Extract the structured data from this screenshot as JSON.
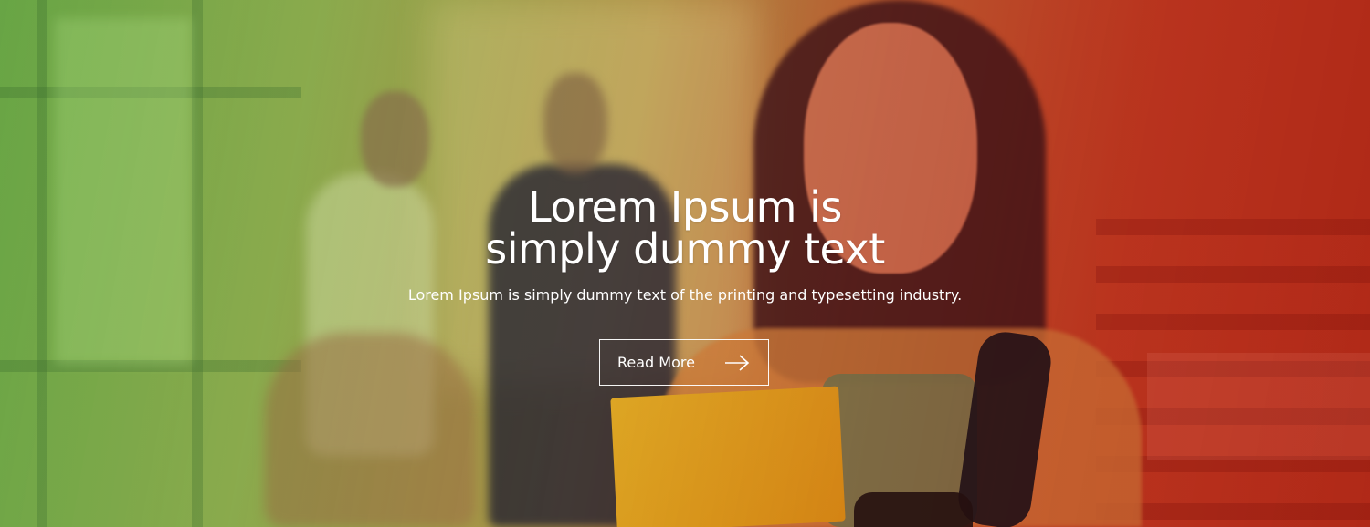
{
  "hero": {
    "headline_line1": "Lorem Ipsum is",
    "headline_line2": "simply dummy text",
    "subtitle": "Lorem Ipsum is simply dummy text of the printing and typesetting industry.",
    "button_label": "Read More",
    "button_icon": "arrow-right-icon",
    "colors": {
      "gradient_left": "#7fb85a",
      "gradient_mid": "#b79a4f",
      "gradient_right": "#c23a22",
      "text": "#ffffff"
    }
  }
}
